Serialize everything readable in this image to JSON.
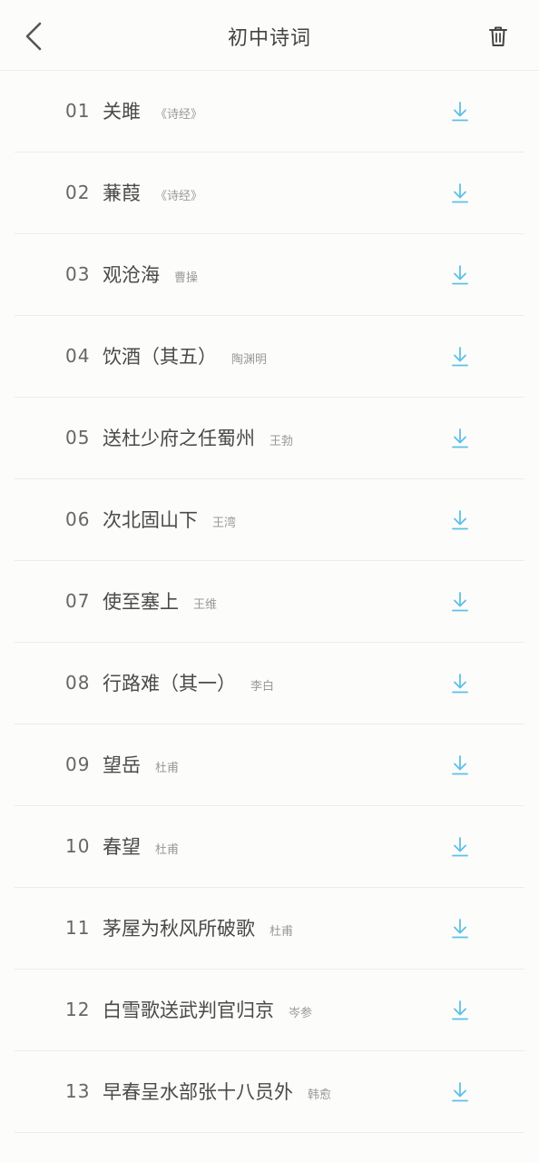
{
  "header": {
    "title": "初中诗词"
  },
  "poems": [
    {
      "num": "01",
      "title": "关雎",
      "author": "《诗经》"
    },
    {
      "num": "02",
      "title": "蒹葭",
      "author": "《诗经》"
    },
    {
      "num": "03",
      "title": "观沧海",
      "author": "曹操"
    },
    {
      "num": "04",
      "title": "饮酒（其五）",
      "author": "陶渊明"
    },
    {
      "num": "05",
      "title": "送杜少府之任蜀州",
      "author": "王勃"
    },
    {
      "num": "06",
      "title": "次北固山下",
      "author": "王湾"
    },
    {
      "num": "07",
      "title": "使至塞上",
      "author": "王维"
    },
    {
      "num": "08",
      "title": "行路难（其一）",
      "author": "李白"
    },
    {
      "num": "09",
      "title": "望岳",
      "author": "杜甫"
    },
    {
      "num": "10",
      "title": "春望",
      "author": "杜甫"
    },
    {
      "num": "11",
      "title": "茅屋为秋风所破歌",
      "author": "杜甫"
    },
    {
      "num": "12",
      "title": "白雪歌送武判官归京",
      "author": "岑参"
    },
    {
      "num": "13",
      "title": "早春呈水部张十八员外",
      "author": "韩愈"
    }
  ],
  "icons": {
    "back": "chevron-left-icon",
    "trash": "trash-icon",
    "download": "download-icon"
  },
  "colors": {
    "accent": "#5bc0e8",
    "background": "#fcfcfa"
  }
}
